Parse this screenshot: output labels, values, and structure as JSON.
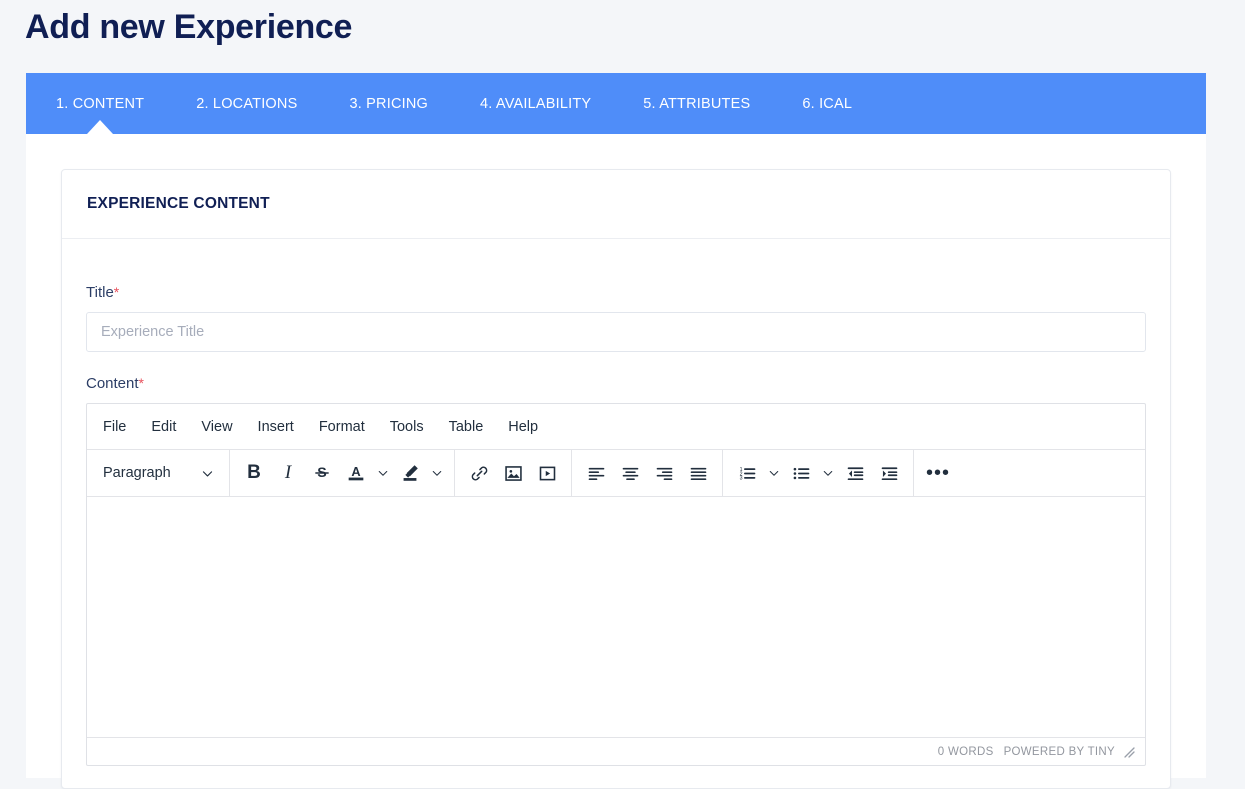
{
  "page": {
    "title": "Add new Experience"
  },
  "tabs": [
    {
      "label": "1. CONTENT",
      "active": true
    },
    {
      "label": "2. LOCATIONS",
      "active": false
    },
    {
      "label": "3. PRICING",
      "active": false
    },
    {
      "label": "4. AVAILABILITY",
      "active": false
    },
    {
      "label": "5. ATTRIBUTES",
      "active": false
    },
    {
      "label": "6. ICAL",
      "active": false
    }
  ],
  "card": {
    "header": "EXPERIENCE CONTENT",
    "fields": {
      "title": {
        "label": "Title",
        "required_marker": "*",
        "value": "",
        "placeholder": "Experience Title"
      },
      "content": {
        "label": "Content",
        "required_marker": "*",
        "value": ""
      }
    }
  },
  "editor": {
    "menubar": [
      "File",
      "Edit",
      "View",
      "Insert",
      "Format",
      "Tools",
      "Table",
      "Help"
    ],
    "format_select": {
      "value": "Paragraph",
      "icon": "chevron-down-icon"
    },
    "toolbar_groups": [
      {
        "name": "formatting",
        "buttons": [
          {
            "name": "bold-button",
            "glyph": "B"
          },
          {
            "name": "italic-button",
            "glyph": "I"
          },
          {
            "name": "strikethrough-button",
            "glyph": "S"
          },
          {
            "name": "text-color-button",
            "glyph": "A"
          },
          {
            "name": "text-color-chevron",
            "glyph": "chevron-down-icon"
          },
          {
            "name": "background-color-button",
            "glyph": "highlight-pen-icon"
          },
          {
            "name": "background-color-chevron",
            "glyph": "chevron-down-icon"
          }
        ]
      },
      {
        "name": "insert",
        "buttons": [
          {
            "name": "insert-link-button",
            "glyph": "link-icon"
          },
          {
            "name": "insert-image-button",
            "glyph": "image-icon"
          },
          {
            "name": "insert-media-button",
            "glyph": "media-play-icon"
          }
        ]
      },
      {
        "name": "alignment",
        "buttons": [
          {
            "name": "align-left-button",
            "glyph": "align-left-icon"
          },
          {
            "name": "align-center-button",
            "glyph": "align-center-icon"
          },
          {
            "name": "align-right-button",
            "glyph": "align-right-icon"
          },
          {
            "name": "align-justify-button",
            "glyph": "align-justify-icon"
          }
        ]
      },
      {
        "name": "lists",
        "buttons": [
          {
            "name": "numbered-list-button",
            "glyph": "numbered-list-icon"
          },
          {
            "name": "numbered-list-chevron",
            "glyph": "chevron-down-icon"
          },
          {
            "name": "bullet-list-button",
            "glyph": "bullet-list-icon"
          },
          {
            "name": "bullet-list-chevron",
            "glyph": "chevron-down-icon"
          },
          {
            "name": "outdent-button",
            "glyph": "outdent-icon"
          },
          {
            "name": "indent-button",
            "glyph": "indent-icon"
          }
        ]
      },
      {
        "name": "overflow",
        "buttons": [
          {
            "name": "more-toolbar-button",
            "glyph": "ellipsis-icon"
          }
        ]
      }
    ],
    "statusbar": {
      "word_count": "0 WORDS",
      "branding": "POWERED BY TINY",
      "resize_handle": "resize-handle-icon"
    }
  },
  "colors": {
    "accent_blue": "#4f8df9",
    "title_navy": "#101f54",
    "required_red": "#e8505b",
    "page_background": "#f4f6f9"
  }
}
